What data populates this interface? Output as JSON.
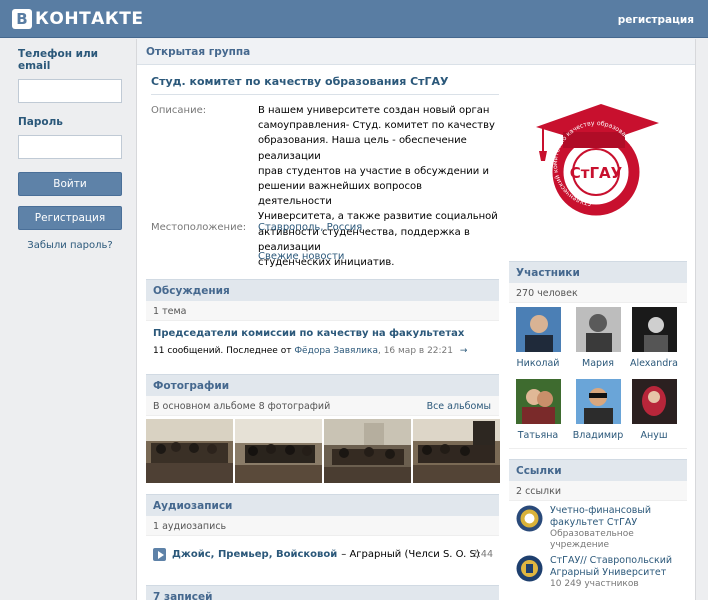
{
  "header": {
    "logo_letter": "В",
    "logo_text": "КОНТАКТЕ",
    "register_link": "регистрация"
  },
  "login": {
    "phone_label": "Телефон или email",
    "password_label": "Пароль",
    "login_button": "Войти",
    "register_button": "Регистрация",
    "forgot_link": "Забыли пароль?"
  },
  "group": {
    "type": "Открытая группа",
    "title": "Студ. комитет по качеству образования СтГАУ",
    "description_label": "Описание:",
    "description_lines": [
      "В нашем университете создан новый орган",
      "самоуправления- Студ. комитет по качеству",
      "образования. Наша цель - обеспечение реализации",
      "прав студентов на участие в обсуждении и",
      "решении важнейших вопросов деятельности",
      "Университета, а также развитие социальной",
      "активности студенчества, поддержка в реализации",
      "студенческих инициатив."
    ],
    "location_label": "Местоположение:",
    "location_value": "Ставрополь, Россия",
    "news_link": "Свежие новости"
  },
  "discussions": {
    "title": "Обсуждения",
    "count": "1 тема",
    "topic_title": "Председатели комиссии по качеству на факультетах",
    "topic_meta_prefix": "11 сообщений. Последнее от ",
    "topic_meta_author": "Фёдора Завялика",
    "topic_meta_date": ", 16 мар в 22:21",
    "arrow": "→"
  },
  "photos": {
    "title": "Фотографии",
    "subtitle": "В основном альбоме 8 фотографий",
    "all_albums": "Все альбомы"
  },
  "audio": {
    "title": "Аудиозаписи",
    "count": "1 аудиозапись",
    "artist": "Джойс, Премьер, Войсковой",
    "song": "– Аграрный (Челси S. O. S)",
    "duration": "2:44"
  },
  "wall": {
    "title": "7 записей"
  },
  "emblem": {
    "text": "СтГАУ",
    "ring_text": "студенческий комитет по качеству образования"
  },
  "members": {
    "title": "Участники",
    "count": "270 человек",
    "items": [
      {
        "name": "Николай"
      },
      {
        "name": "Мария"
      },
      {
        "name": "Alexandra"
      },
      {
        "name": "Татьяна"
      },
      {
        "name": "Владимир"
      },
      {
        "name": "Ануш"
      }
    ]
  },
  "links": {
    "title": "Ссылки",
    "count": "2 ссылки",
    "items": [
      {
        "title": "Учетно-финансовый факультет СтГАУ",
        "title_l1": "Учетно-финансовый",
        "title_l2": "факультет СтГАУ",
        "sub_l1": "Образовательное",
        "sub_l2": "учреждение"
      },
      {
        "title": "СтГАУ// Ставропольский Аграрный Университет",
        "title_l1": "СтГАУ// Ставропольский",
        "title_l2": "Аграрный Университет",
        "sub_l1": "10 249 участников"
      }
    ]
  },
  "colors": {
    "header_blue": "#597da3",
    "link_blue": "#2b587a",
    "emblem_red": "#c8102e"
  }
}
